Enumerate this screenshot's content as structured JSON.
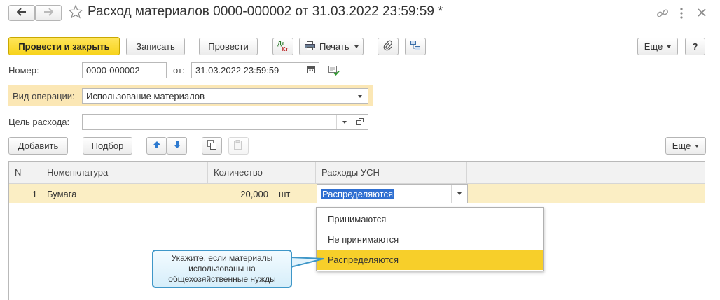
{
  "window": {
    "title": "Расход материалов 0000-000002 от 31.03.2022 23:59:59 *"
  },
  "toolbar": {
    "post_close": "Провести и закрыть",
    "save": "Записать",
    "post": "Провести",
    "dt_kt_top": "Дт",
    "dt_kt_bottom": "Кт",
    "print": "Печать",
    "more": "Еще",
    "help": "?"
  },
  "form": {
    "number_label": "Номер:",
    "number_value": "0000-000002",
    "date_label": "от:",
    "date_value": "31.03.2022 23:59:59",
    "operation_label": "Вид операции:",
    "operation_value": "Использование материалов",
    "purpose_label": "Цель расхода:",
    "purpose_value": ""
  },
  "table_toolbar": {
    "add": "Добавить",
    "pick": "Подбор",
    "more": "Еще"
  },
  "table": {
    "columns": [
      "N",
      "Номенклатура",
      "Количество",
      "Расходы УСН"
    ],
    "rows": [
      {
        "n": "1",
        "item": "Бумага",
        "qty": "20,000",
        "unit": "шт",
        "usn": "Распределяются"
      }
    ]
  },
  "dropdown": {
    "options": [
      "Принимаются",
      "Не принимаются",
      "Распределяются"
    ],
    "selected": "Распределяются"
  },
  "tooltip": {
    "text": "Укажите, если материалы использованы на общехозяйственные нужды"
  },
  "colors": {
    "primary_button": "#f7d31c",
    "row_highlight": "#fbeec4",
    "selection": "#f7cf2a",
    "tooltip_border": "#3f97c8"
  }
}
